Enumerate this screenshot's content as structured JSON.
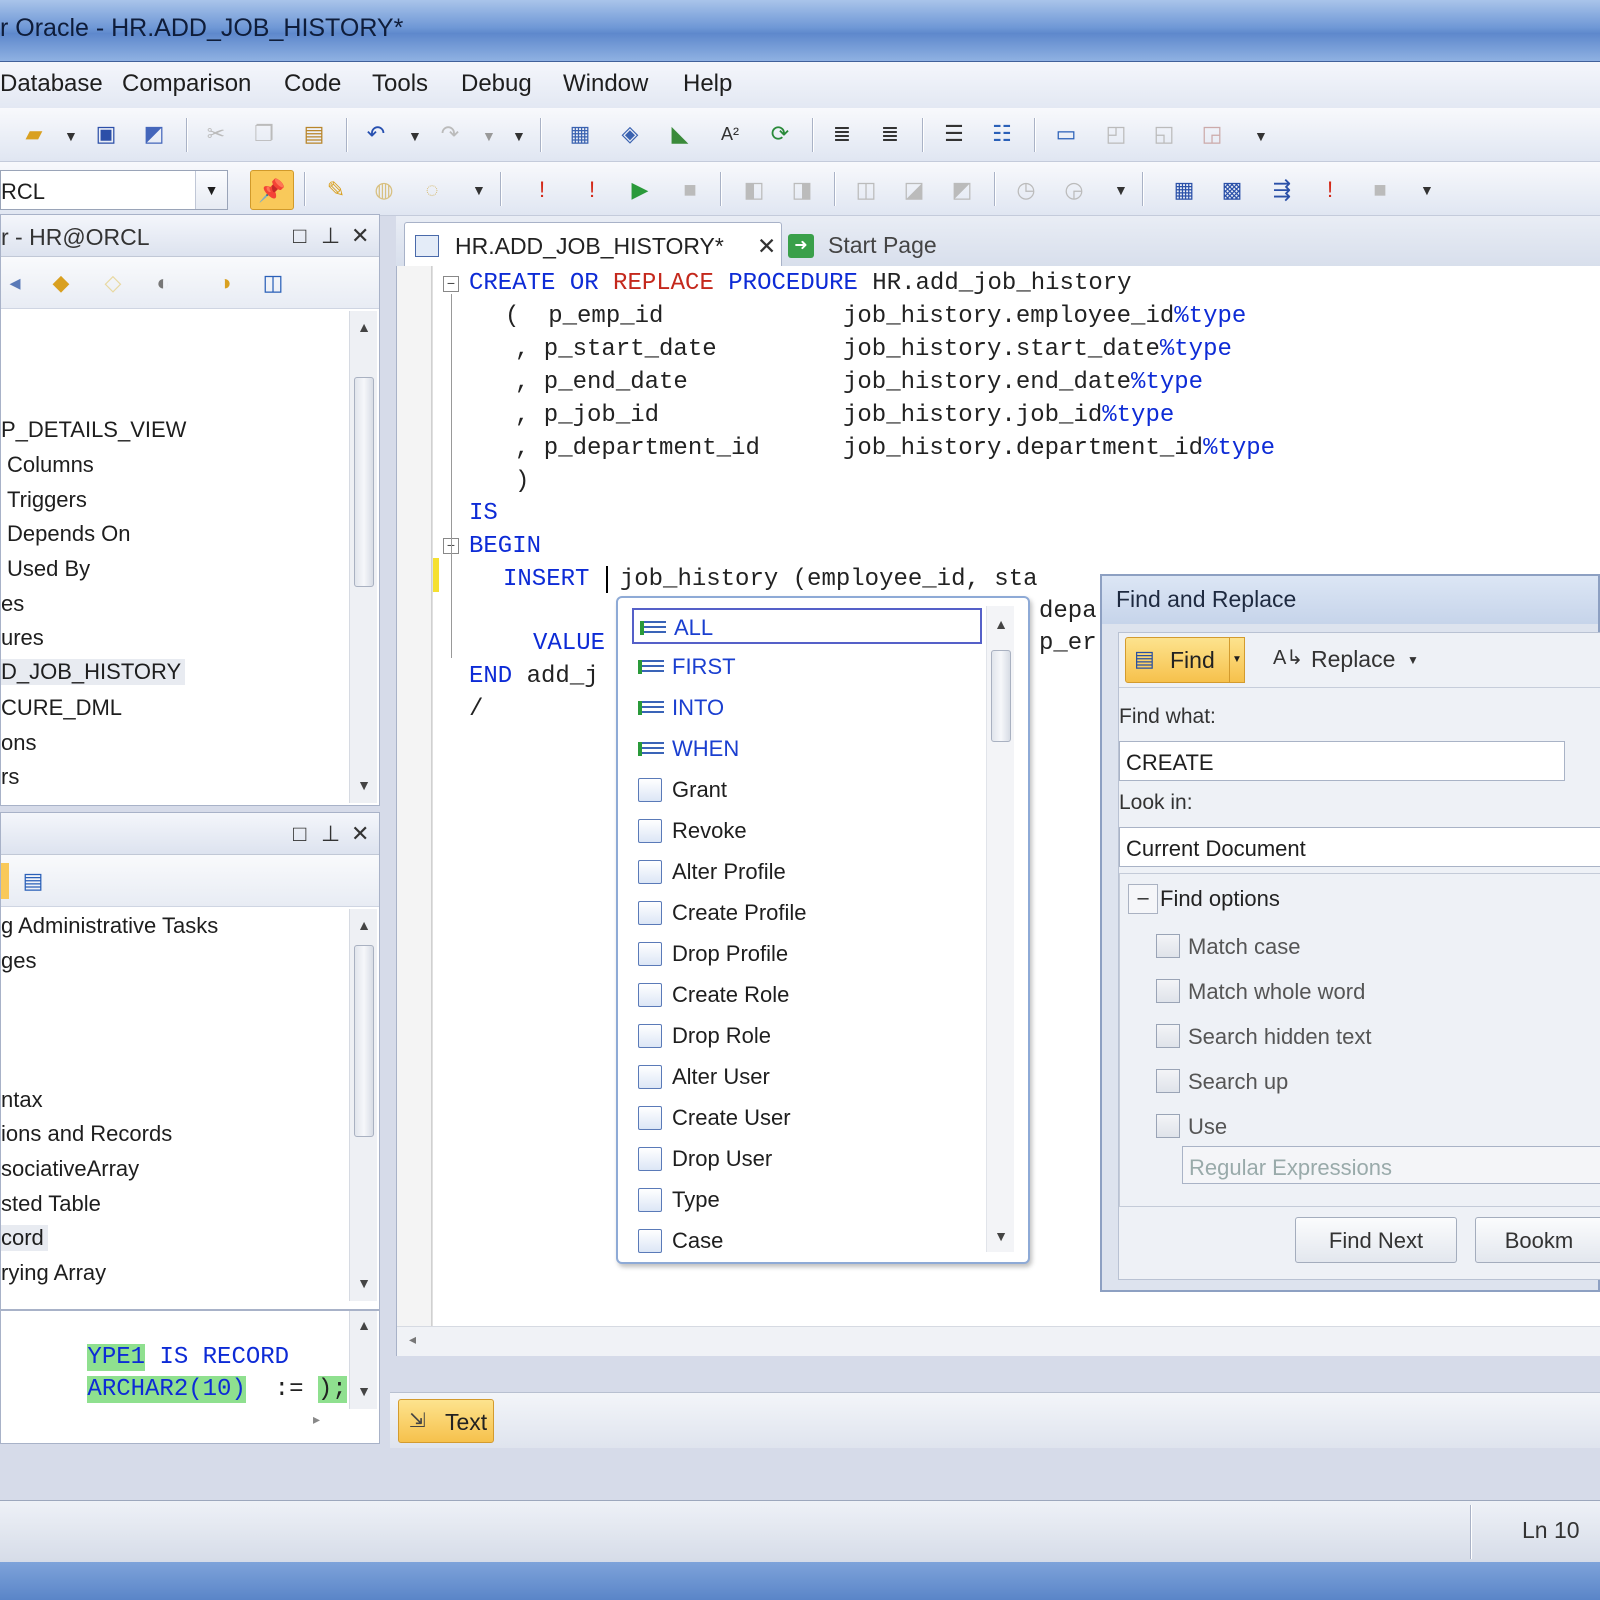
{
  "window": {
    "title": "r Oracle - HR.ADD_JOB_HISTORY*"
  },
  "menu": [
    "Database",
    "Comparison",
    "Code",
    "Tools",
    "Debug",
    "Window",
    "Help"
  ],
  "connection_combo": {
    "value": "RCL"
  },
  "db_explorer": {
    "title": "r - HR@ORCL",
    "items": [
      "P_DETAILS_VIEW",
      "Columns",
      "Triggers",
      "Depends On",
      "Used By",
      "es",
      "ures",
      "D_JOB_HISTORY",
      "CURE_DML",
      "ons",
      "rs"
    ]
  },
  "snippets_panel": {
    "items": [
      "g Administrative Tasks",
      "ges",
      "ntax",
      "ions and Records",
      "sociativeArray",
      "sted Table",
      "cord",
      "rying Array"
    ],
    "preview": {
      "line1_a": "YPE1",
      "line1_b": "IS",
      "line1_c": "RECORD",
      "line2_a": "ARCHAR2(10)",
      "line2_b": ":=",
      "line2_c": ");"
    }
  },
  "tabs": [
    {
      "label": "HR.ADD_JOB_HISTORY*",
      "active": true
    },
    {
      "label": "Start Page",
      "active": false
    }
  ],
  "editor": {
    "lines": {
      "l1_kw1": "CREATE",
      "l1_kw2": "OR",
      "l1_kw3": "REPLACE",
      "l1_kw4": "PROCEDURE",
      "l1_rest": " HR.add_job_history",
      "l2_a": "(  p_emp_id",
      "l2_b": "job_history.employee_id",
      "l2_c": "%type",
      "l3_a": ", p_start_date",
      "l3_b": "job_history.start_date",
      "l3_c": "%type",
      "l4_a": ", p_end_date",
      "l4_b": "job_history.end_date",
      "l4_c": "%type",
      "l5_a": ", p_job_id",
      "l5_b": "job_history.job_id",
      "l5_c": "%type",
      "l6_a": ", p_department_id",
      "l6_b": "job_history.department_id",
      "l6_c": "%type",
      "l7": ")",
      "l8": "IS",
      "l9": "BEGIN",
      "l10_kw": "INSERT",
      "l10_rest": "job_history (employee_id, sta",
      "l11_rest": "depa",
      "l12_kw": "VALUE",
      "l12_rest": "p_er",
      "l13_kw": "END",
      "l13_rest": " add_j",
      "l14": "/"
    }
  },
  "autocomplete": {
    "items": [
      {
        "label": "ALL",
        "kind": "keyword",
        "selected": true
      },
      {
        "label": "FIRST",
        "kind": "keyword"
      },
      {
        "label": "INTO",
        "kind": "keyword"
      },
      {
        "label": "WHEN",
        "kind": "keyword"
      },
      {
        "label": "Grant",
        "kind": "snippet"
      },
      {
        "label": "Revoke",
        "kind": "snippet"
      },
      {
        "label": "Alter Profile",
        "kind": "snippet"
      },
      {
        "label": "Create Profile",
        "kind": "snippet"
      },
      {
        "label": "Drop Profile",
        "kind": "snippet"
      },
      {
        "label": "Create Role",
        "kind": "snippet"
      },
      {
        "label": "Drop Role",
        "kind": "snippet"
      },
      {
        "label": "Alter User",
        "kind": "snippet"
      },
      {
        "label": "Create User",
        "kind": "snippet"
      },
      {
        "label": "Drop User",
        "kind": "snippet"
      },
      {
        "label": "Type",
        "kind": "snippet"
      },
      {
        "label": "Case",
        "kind": "snippet"
      }
    ]
  },
  "find_replace": {
    "title": "Find and Replace",
    "find_tab": "Find",
    "replace_tab": "Replace",
    "find_what_label": "Find what:",
    "find_what_value": "CREATE",
    "look_in_label": "Look in:",
    "look_in_value": "Current Document",
    "options_header": "Find options",
    "options_toggle": "–",
    "options": [
      "Match case",
      "Match whole word",
      "Search hidden text",
      "Search up",
      "Use"
    ],
    "regex_value": "Regular Expressions",
    "find_next": "Find Next",
    "bookmark": "Bookm"
  },
  "bottom": {
    "text_tab": "Text"
  },
  "status": {
    "position": "Ln 10"
  },
  "colors": {
    "keyword": "#0d2bd6",
    "keyword_red": "#c4281c",
    "accent_orange": "#f9c95a"
  }
}
